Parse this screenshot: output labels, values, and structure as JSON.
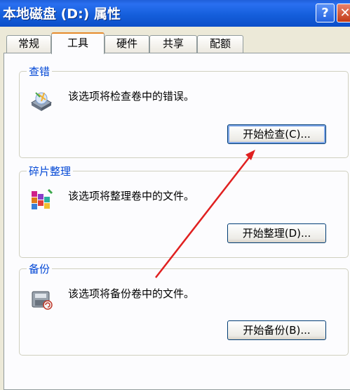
{
  "window": {
    "title": "本地磁盘 (D:) 属性",
    "help_glyph": "?",
    "close_glyph": "✕"
  },
  "tabs": [
    "常规",
    "工具",
    "硬件",
    "共享",
    "配额"
  ],
  "active_tab": "工具",
  "groups": {
    "error_check": {
      "title": "查错",
      "description": "该选项将检查卷中的错误。",
      "button": "开始检查(C)...",
      "icon": "disk-check-icon"
    },
    "defrag": {
      "title": "碎片整理",
      "description": "该选项将整理卷中的文件。",
      "button": "开始整理(D)...",
      "icon": "defrag-icon"
    },
    "backup": {
      "title": "备份",
      "description": "该选项将备份卷中的文件。",
      "button": "开始备份(B)...",
      "icon": "backup-icon"
    }
  },
  "annotation": {
    "arrow_color": "#e02020"
  },
  "colors": {
    "titlebar": "#155fdc",
    "group_title": "#0046d5",
    "active_tab_accent": "#e68b2c"
  }
}
